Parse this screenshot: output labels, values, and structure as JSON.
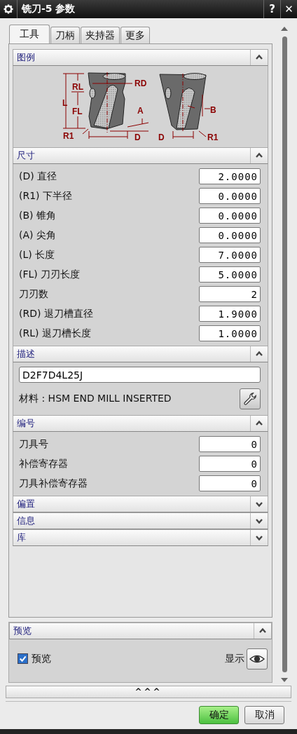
{
  "window": {
    "title": "铣刀-5 参数",
    "help": "?",
    "close": "✕"
  },
  "tabs": [
    {
      "label": "工具",
      "selected": true
    },
    {
      "label": "刀柄",
      "selected": false
    },
    {
      "label": "夹持器",
      "selected": false
    },
    {
      "label": "更多",
      "selected": false
    }
  ],
  "sections": [
    {
      "kind": "legend",
      "title": "图例",
      "expanded": true,
      "labels": [
        "RL",
        "RD",
        "L",
        "FL",
        "A",
        "R1",
        "D",
        "B",
        "D",
        "R1"
      ]
    },
    {
      "kind": "fields",
      "title": "尺寸",
      "expanded": true,
      "fields": [
        {
          "label": "(D) 直径",
          "value": "2.0000"
        },
        {
          "label": "(R1) 下半径",
          "value": "0.0000"
        },
        {
          "label": "(B) 锥角",
          "value": "0.0000"
        },
        {
          "label": "(A) 尖角",
          "value": "0.0000"
        },
        {
          "label": "(L) 长度",
          "value": "7.0000"
        },
        {
          "label": "(FL) 刀刃长度",
          "value": "5.0000"
        },
        {
          "label": "刀刃数",
          "value": "2"
        },
        {
          "label": "(RD) 退刀槽直径",
          "value": "1.9000"
        },
        {
          "label": "(RL) 退刀槽长度",
          "value": "1.0000"
        }
      ]
    },
    {
      "kind": "description",
      "title": "描述",
      "expanded": true,
      "value": "D2F7D4L25J",
      "material": "材料 : HSM END MILL INSERTED"
    },
    {
      "kind": "fields",
      "title": "编号",
      "expanded": true,
      "fields": [
        {
          "label": "刀具号",
          "value": "0"
        },
        {
          "label": "补偿寄存器",
          "value": "0"
        },
        {
          "label": "刀具补偿寄存器",
          "value": "0"
        }
      ]
    },
    {
      "title": "偏置",
      "expanded": false
    },
    {
      "title": "信息",
      "expanded": false
    },
    {
      "title": "库",
      "expanded": false
    }
  ],
  "preview": {
    "title": "预览",
    "expanded": true,
    "checkbox": {
      "label": "预览",
      "checked": true
    },
    "show_label": "显示"
  },
  "more_bar": "^^^",
  "buttons": [
    {
      "label": "确定",
      "kind": "primary"
    },
    {
      "label": "取消",
      "kind": "normal"
    }
  ]
}
